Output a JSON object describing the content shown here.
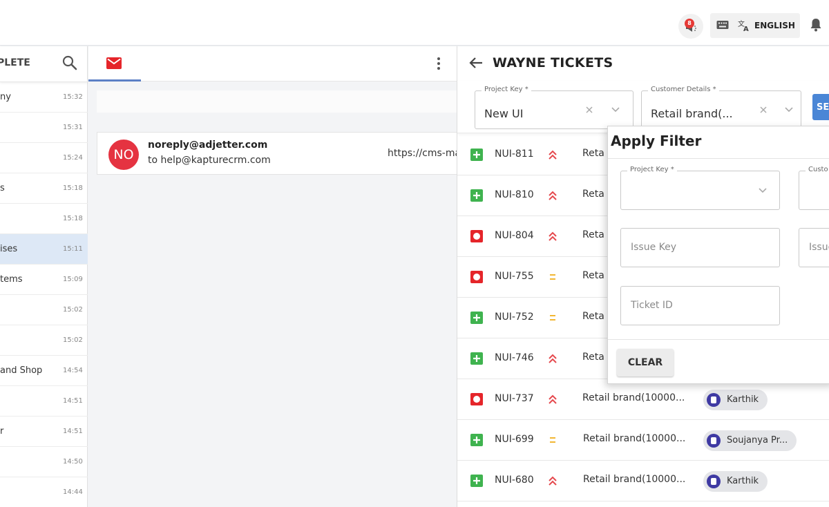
{
  "topbar": {
    "notification_count": "8",
    "language_label": "ENGLISH",
    "icons": [
      "megaphone-icon",
      "keyboard-icon",
      "translate-icon",
      "bell-icon"
    ]
  },
  "conversations": {
    "header_title": "PLETE",
    "items": [
      {
        "name": "ny",
        "time": "15:32"
      },
      {
        "name": "",
        "time": "15:31"
      },
      {
        "name": "",
        "time": "15:24"
      },
      {
        "name": "s",
        "time": "15:18"
      },
      {
        "name": "",
        "time": "15:18"
      },
      {
        "name": "ises",
        "time": "15:11"
      },
      {
        "name": "tems",
        "time": "15:09"
      },
      {
        "name": "",
        "time": "15:02"
      },
      {
        "name": "",
        "time": "15:02"
      },
      {
        "name": "and Shop",
        "time": "14:54"
      },
      {
        "name": "",
        "time": "14:51"
      },
      {
        "name": "r",
        "time": "14:51"
      },
      {
        "name": "",
        "time": "14:50"
      },
      {
        "name": "",
        "time": "14:44"
      }
    ]
  },
  "email": {
    "avatar_initials": "NO",
    "from": "noreply@adjetter.com",
    "to": "to help@kapturecrm.com",
    "link_preview": "https://cms-ma"
  },
  "tickets": {
    "title": "WAYNE TICKETS",
    "filters": {
      "project_key_label": "Project Key *",
      "project_key_value": "New UI",
      "customer_details_label": "Customer Details *",
      "customer_details_value": "Retail brand(...",
      "search_label": "SEA"
    },
    "rows": [
      {
        "key": "NUI-811",
        "summary": "Reta",
        "assignee": "",
        "type": "story",
        "priority": "high"
      },
      {
        "key": "NUI-810",
        "summary": "Reta",
        "assignee": "",
        "type": "story",
        "priority": "high"
      },
      {
        "key": "NUI-804",
        "summary": "Reta",
        "assignee": "",
        "type": "bug",
        "priority": "high"
      },
      {
        "key": "NUI-755",
        "summary": "Reta",
        "assignee": "",
        "type": "bug",
        "priority": "medium"
      },
      {
        "key": "NUI-752",
        "summary": "Reta",
        "assignee": "",
        "type": "story",
        "priority": "medium"
      },
      {
        "key": "NUI-746",
        "summary": "Reta",
        "assignee": "",
        "type": "story",
        "priority": "high"
      },
      {
        "key": "NUI-737",
        "summary": "Retail brand(10000...",
        "assignee": "Karthik",
        "type": "bug",
        "priority": "high"
      },
      {
        "key": "NUI-699",
        "summary": "Retail brand(10000...",
        "assignee": "Soujanya Pr...",
        "type": "story",
        "priority": "medium"
      },
      {
        "key": "NUI-680",
        "summary": "Retail brand(10000...",
        "assignee": "Karthik",
        "type": "story",
        "priority": "high"
      }
    ]
  },
  "apply_filter": {
    "title": "Apply Filter",
    "project_key_label": "Project Key *",
    "customer_label": "Custo",
    "issue_key_placeholder": "Issue Key",
    "issue_placeholder_2": "Issue",
    "ticket_id_placeholder": "Ticket ID",
    "clear_label": "CLEAR"
  },
  "colors": {
    "accent_blue": "#4a86d6",
    "story_green": "#3fb34f",
    "bug_red": "#e5252a",
    "priority_high": "#e5484d",
    "priority_medium": "#f2b632",
    "avatar_red": "#e53341",
    "active_row": "#dde8f6"
  }
}
